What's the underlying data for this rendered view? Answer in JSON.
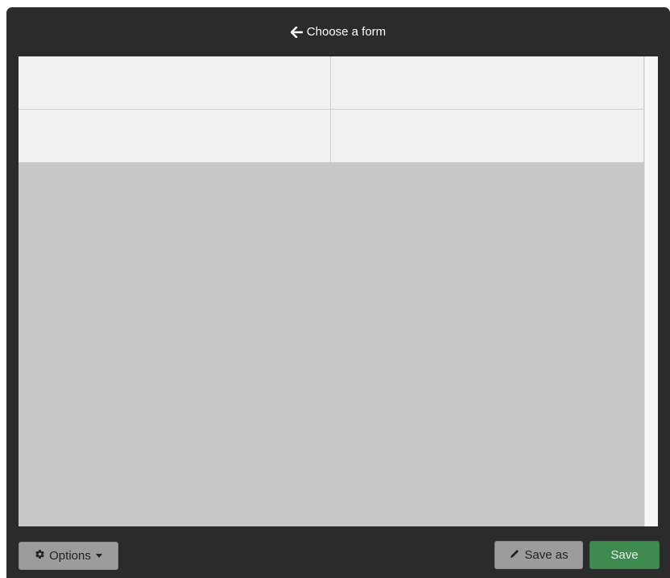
{
  "header": {
    "title": "Choose a form",
    "back_icon": "arrow-left-icon"
  },
  "form_grid": {
    "rows": [
      [
        "",
        ""
      ],
      [
        "",
        ""
      ]
    ]
  },
  "footer": {
    "options_label": "Options",
    "options_icon": "gear-icon",
    "save_as_label": "Save as",
    "save_as_icon": "pencil-icon",
    "save_label": "Save"
  },
  "colors": {
    "frame": "#2b2b2b",
    "content_bg": "#c7c7c7",
    "cell_bg": "#f2f2f2",
    "save_green": "#3f8a4f",
    "secondary_button": "#9c9c9c"
  }
}
